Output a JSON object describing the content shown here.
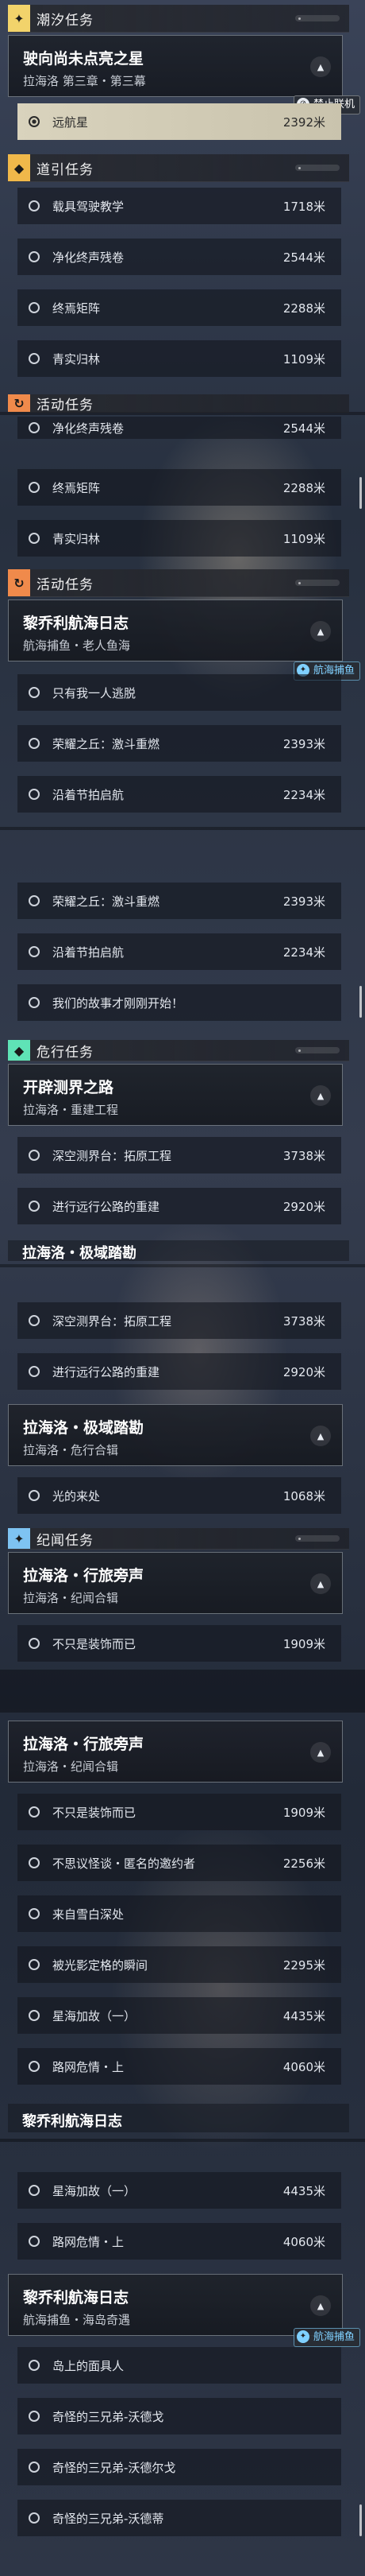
{
  "categories": {
    "chaoxi": {
      "icon": "✦",
      "color": "#f2d36b",
      "title": "潮汐任务"
    },
    "daoyin": {
      "icon": "◆",
      "color": "#f0b84a",
      "title": "道引任务"
    },
    "huodong": {
      "icon": "↻",
      "color": "#f08a4b",
      "title": "活动任务"
    },
    "weixing": {
      "icon": "◆",
      "color": "#5fe3b6",
      "title": "危行任务"
    },
    "jiwen": {
      "icon": "✦",
      "color": "#7ec3f2",
      "title": "纪闻任务"
    }
  },
  "seg1": {
    "mission_title": "驶向尚未点亮之星",
    "mission_sub": "拉海洛 第三章・第三幕",
    "tag": "禁止联机",
    "active_step": {
      "label": "远航星",
      "dist": "2392米"
    },
    "daoyin_steps": [
      {
        "label": "载具驾驶教学",
        "dist": "1718米"
      },
      {
        "label": "净化终声残卷",
        "dist": "2544米"
      },
      {
        "label": "终焉矩阵",
        "dist": "2288米"
      },
      {
        "label": "青实归林",
        "dist": "1109米"
      }
    ]
  },
  "seg2": {
    "top_steps": [
      {
        "label": "净化终声残卷",
        "dist": "2544米"
      },
      {
        "label": "终焉矩阵",
        "dist": "2288米"
      },
      {
        "label": "青实归林",
        "dist": "1109米"
      }
    ],
    "mission_title": "黎乔利航海日志",
    "mission_sub": "航海捕鱼・老人鱼海",
    "tag": "航海捕鱼",
    "steps": [
      {
        "label": "只有我一人逃脱",
        "dist": ""
      },
      {
        "label": "荣耀之丘：激斗重燃",
        "dist": "2393米"
      },
      {
        "label": "沿着节拍启航",
        "dist": "2234米"
      }
    ]
  },
  "seg3": {
    "top_steps": [
      {
        "label": "荣耀之丘：激斗重燃",
        "dist": "2393米"
      },
      {
        "label": "沿着节拍启航",
        "dist": "2234米"
      },
      {
        "label": "我们的故事才刚刚开始！",
        "dist": ""
      }
    ],
    "mission_title": "开辟测界之路",
    "mission_sub": "拉海洛・重建工程",
    "steps": [
      {
        "label": "深空测界台：拓原工程",
        "dist": "3738米"
      },
      {
        "label": "进行远行公路的重建",
        "dist": "2920米"
      }
    ],
    "next_title": "拉海洛・极域踏勘"
  },
  "seg4": {
    "top_steps": [
      {
        "label": "深空测界台：拓原工程",
        "dist": "3738米"
      },
      {
        "label": "进行远行公路的重建",
        "dist": "2920米"
      }
    ],
    "mission_title": "拉海洛・极域踏勘",
    "mission_sub": "拉海洛・危行合辑",
    "steps": [
      {
        "label": "光的来处",
        "dist": "1068米"
      }
    ],
    "jiwen_title": "拉海洛・行旅旁声",
    "jiwen_sub": "拉海洛・纪闻合辑",
    "jiwen_steps": [
      {
        "label": "不只是装饰而已",
        "dist": "1909米"
      }
    ]
  },
  "seg5": {
    "mission_title": "拉海洛・行旅旁声",
    "mission_sub": "拉海洛・纪闻合辑",
    "steps": [
      {
        "label": "不只是装饰而已",
        "dist": "1909米"
      },
      {
        "label": "不思议怪谈・匿名的邀约者",
        "dist": "2256米"
      },
      {
        "label": "来自雪白深处",
        "dist": ""
      },
      {
        "label": "被光影定格的瞬间",
        "dist": "2295米"
      },
      {
        "label": "星海加故（一）",
        "dist": "4435米"
      },
      {
        "label": "路网危情・上",
        "dist": "4060米"
      }
    ],
    "next_title": "黎乔利航海日志"
  },
  "seg6": {
    "top_steps": [
      {
        "label": "星海加故（一）",
        "dist": "4435米"
      },
      {
        "label": "路网危情・上",
        "dist": "4060米"
      }
    ],
    "mission_title": "黎乔利航海日志",
    "mission_sub": "航海捕鱼・海岛奇遇",
    "tag": "航海捕鱼",
    "steps": [
      {
        "label": "岛上的面具人",
        "dist": ""
      },
      {
        "label": "奇怪的三兄弟-沃德戈",
        "dist": ""
      },
      {
        "label": "奇怪的三兄弟-沃德尔戈",
        "dist": ""
      },
      {
        "label": "奇怪的三兄弟-沃德蒂",
        "dist": ""
      }
    ]
  }
}
